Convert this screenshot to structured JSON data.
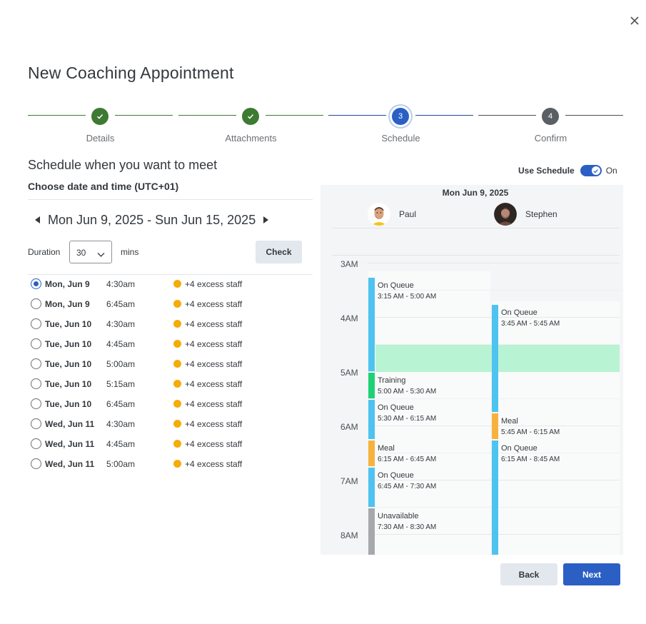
{
  "dialog": {
    "title": "New Coaching Appointment",
    "subtitle": "Schedule when you want to meet",
    "choose_label": "Choose date and time (UTC+01)"
  },
  "stepper": {
    "steps": [
      {
        "label": "Details",
        "status": "done",
        "number": "1"
      },
      {
        "label": "Attachments",
        "status": "done",
        "number": "2"
      },
      {
        "label": "Schedule",
        "status": "active",
        "number": "3"
      },
      {
        "label": "Confirm",
        "status": "todo",
        "number": "4"
      }
    ]
  },
  "use_schedule": {
    "label": "Use Schedule",
    "state": "On",
    "enabled": true
  },
  "week": {
    "range": "Mon Jun 9, 2025 - Sun Jun 15, 2025"
  },
  "duration": {
    "label": "Duration",
    "value": "30",
    "unit": "mins",
    "check_label": "Check"
  },
  "slots": [
    {
      "day": "Mon, Jun 9",
      "time": "4:30am",
      "staff": "+4 excess staff",
      "selected": true
    },
    {
      "day": "Mon, Jun 9",
      "time": "6:45am",
      "staff": "+4 excess staff",
      "selected": false
    },
    {
      "day": "Tue, Jun 10",
      "time": "4:30am",
      "staff": "+4 excess staff",
      "selected": false
    },
    {
      "day": "Tue, Jun 10",
      "time": "4:45am",
      "staff": "+4 excess staff",
      "selected": false
    },
    {
      "day": "Tue, Jun 10",
      "time": "5:00am",
      "staff": "+4 excess staff",
      "selected": false
    },
    {
      "day": "Tue, Jun 10",
      "time": "5:15am",
      "staff": "+4 excess staff",
      "selected": false
    },
    {
      "day": "Tue, Jun 10",
      "time": "6:45am",
      "staff": "+4 excess staff",
      "selected": false
    },
    {
      "day": "Wed, Jun 11",
      "time": "4:30am",
      "staff": "+4 excess staff",
      "selected": false
    },
    {
      "day": "Wed, Jun 11",
      "time": "4:45am",
      "staff": "+4 excess staff",
      "selected": false
    },
    {
      "day": "Wed, Jun 11",
      "time": "5:00am",
      "staff": "+4 excess staff",
      "selected": false
    }
  ],
  "schedule": {
    "date": "Mon Jun 9, 2025",
    "agents": [
      {
        "name": "Paul",
        "avatar": "avatar-paul"
      },
      {
        "name": "Stephen",
        "avatar": "avatar-stephen"
      }
    ],
    "hours": [
      "3AM",
      "4AM",
      "5AM",
      "6AM",
      "7AM",
      "8AM"
    ],
    "paul_events": [
      {
        "title": "On Queue",
        "time": "3:15 AM - 5:00 AM",
        "color": "#4ec3f0"
      },
      {
        "title": "Training",
        "time": "5:00 AM - 5:30 AM",
        "color": "#1fd175"
      },
      {
        "title": "On Queue",
        "time": "5:30 AM - 6:15 AM",
        "color": "#4ec3f0"
      },
      {
        "title": "Meal",
        "time": "6:15 AM - 6:45 AM",
        "color": "#f7b23d"
      },
      {
        "title": "On Queue",
        "time": "6:45 AM - 7:30 AM",
        "color": "#4ec3f0"
      },
      {
        "title": "Unavailable",
        "time": "7:30 AM - 8:30 AM",
        "color": "#a6a8ab"
      }
    ],
    "stephen_events": [
      {
        "title": "On Queue",
        "time": "3:45 AM - 5:45 AM",
        "color": "#4ec3f0"
      },
      {
        "title": "Meal",
        "time": "5:45 AM - 6:15 AM",
        "color": "#f7b23d"
      },
      {
        "title": "On Queue",
        "time": "6:15 AM - 8:45 AM",
        "color": "#4ec3f0"
      }
    ],
    "highlight_color": "#b8f3d3"
  },
  "footer": {
    "back_label": "Back",
    "next_label": "Next"
  },
  "colors": {
    "accent": "#2b5fc4",
    "done": "#3d7a32",
    "excess_dot": "#f5ac07"
  }
}
